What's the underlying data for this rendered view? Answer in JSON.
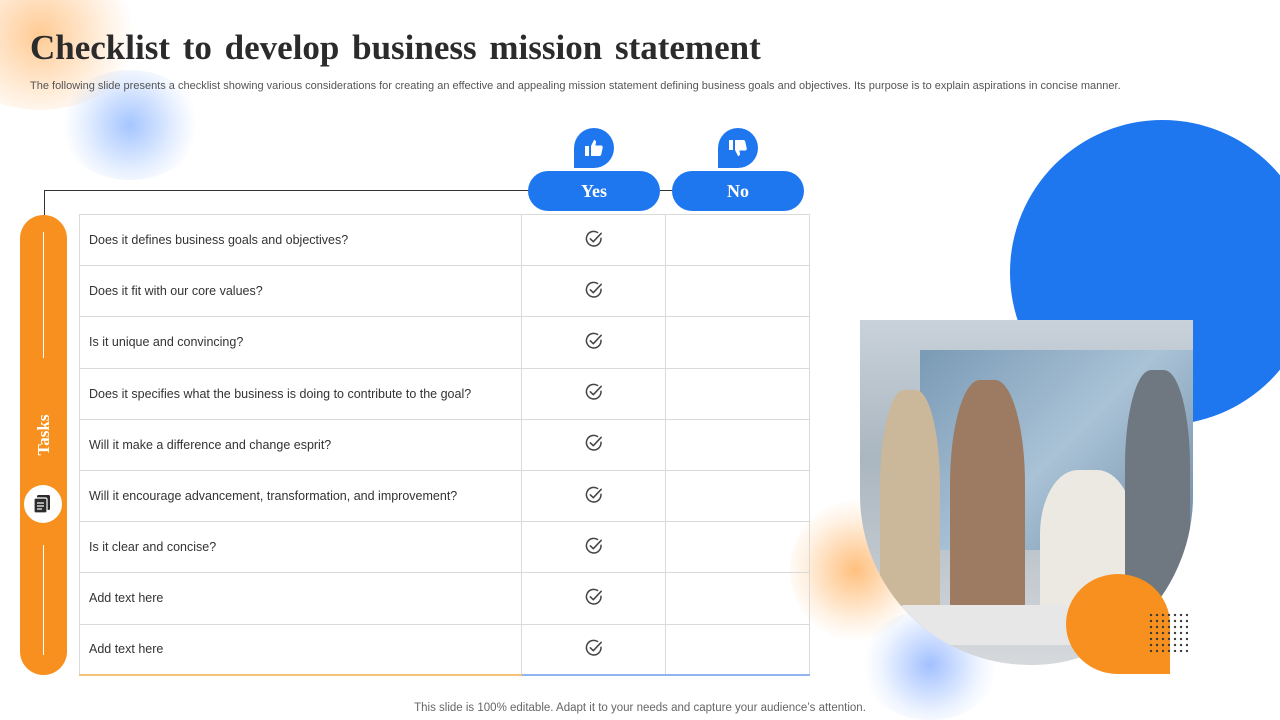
{
  "slide": {
    "title": "Checklist to develop business mission statement",
    "subtitle": "The following slide presents a checklist showing various considerations for creating an effective and appealing mission statement defining business goals and objectives. Its purpose is to explain aspirations in concise manner.",
    "footer": "This slide is 100% editable. Adapt it to your needs and capture your audience’s attention."
  },
  "checklist": {
    "side_label": "Tasks",
    "yes_label": "Yes",
    "no_label": "No",
    "rows": [
      {
        "task": "Does it defines business goals and objectives?",
        "yes": true,
        "no": false
      },
      {
        "task": "Does it fit with our core values?",
        "yes": true,
        "no": false
      },
      {
        "task": "Is it unique and convincing?",
        "yes": true,
        "no": false
      },
      {
        "task": "Does it specifies what the business is doing to contribute to the goal?",
        "yes": true,
        "no": false
      },
      {
        "task": "Will it make a difference and change esprit?",
        "yes": true,
        "no": false
      },
      {
        "task": "Will it encourage advancement, transformation, and improvement?",
        "yes": true,
        "no": false
      },
      {
        "task": "Is it clear and concise?",
        "yes": true,
        "no": false
      },
      {
        "task": "Add text here",
        "yes": true,
        "no": false
      },
      {
        "task": "Add text here",
        "yes": true,
        "no": false
      }
    ]
  },
  "icons": {
    "yes_header": "thumbs-up-icon",
    "no_header": "thumbs-down-icon",
    "side": "document-stack-icon",
    "check": "check-circle-icon"
  },
  "colors": {
    "accent_blue": "#1f77f0",
    "accent_orange": "#f7901e"
  }
}
